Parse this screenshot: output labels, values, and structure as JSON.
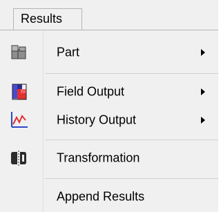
{
  "menubar": {
    "title": "Results"
  },
  "menu": {
    "items": [
      {
        "label": "Part",
        "icon": "part-icon",
        "has_submenu": true
      },
      {
        "label": "Field Output",
        "icon": "field-output-icon",
        "has_submenu": true
      },
      {
        "label": "History Output",
        "icon": "history-output-icon",
        "has_submenu": true
      },
      {
        "label": "Transformation",
        "icon": "transformation-icon",
        "has_submenu": false
      },
      {
        "label": "Append Results",
        "icon": "",
        "has_submenu": false
      }
    ]
  }
}
